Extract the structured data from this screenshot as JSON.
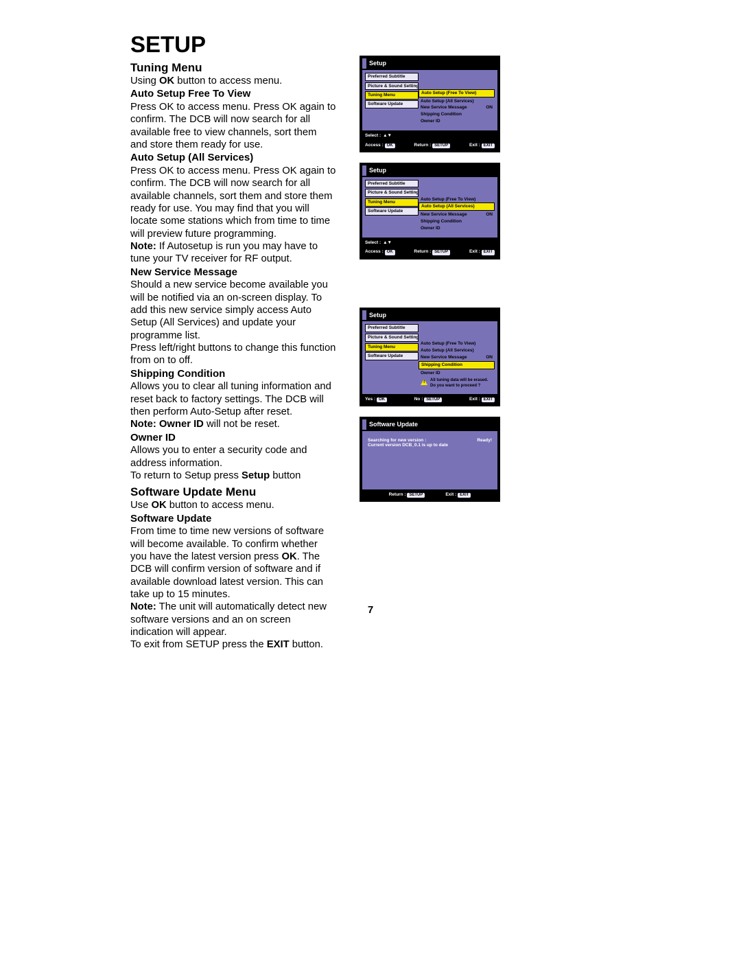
{
  "page": {
    "title": "SETUP",
    "number": "7"
  },
  "sections": {
    "tuning_menu": {
      "heading": "Tuning Menu",
      "intro_pre": "Using ",
      "intro_bold": "OK",
      "intro_post": " button to access menu.",
      "auto_free": {
        "heading": "Auto Setup Free To View",
        "body": "Press OK to access menu. Press OK again to confirm. The DCB will now search for all available free to view channels, sort them and store them ready for use."
      },
      "auto_all": {
        "heading": "Auto Setup (All Services)",
        "body": "Press OK to access menu. Press OK again to confirm. The DCB will now search for all available channels, sort them and store them ready for use. You may find that you will locate some stations which from time to time will preview future programming.",
        "note_label": "Note:",
        "note_body": " If Autosetup is run you may have to tune your TV receiver for RF output."
      },
      "new_service": {
        "heading": "New Service Message",
        "body1": "Should a new service become available you will be notified via an on-screen display. To add this new service simply access Auto Setup (All Services) and update your programme list.",
        "body2": "Press left/right buttons to change this function from on to off."
      },
      "shipping": {
        "heading": "Shipping Condition",
        "body": "Allows you to clear all tuning information and reset back to factory settings. The DCB will then perform Auto-Setup after reset.",
        "note_label": "Note: Owner ID",
        "note_body": " will not be reset."
      },
      "owner": {
        "heading": "Owner ID",
        "body": "Allows you to enter a security code and address information.",
        "return_pre": "To return to Setup press ",
        "return_bold": "Setup",
        "return_post": " button"
      }
    },
    "software_menu": {
      "heading": "Software Update Menu",
      "intro_pre": "Use ",
      "intro_bold": "OK",
      "intro_post": " button to access menu.",
      "sw_update": {
        "heading": "Software Update",
        "body_pre": "From time to time new versions of software will become available. To confirm whether you have the latest version press ",
        "body_bold": "OK",
        "body_post": ". The DCB will confirm version of software and if available download latest version. This can take up to 15 minutes.",
        "note_label": "Note:",
        "note_body": " The unit will automatically detect new software versions and an on screen indication will appear.",
        "exit_pre": "To exit from SETUP press the ",
        "exit_bold": "EXIT",
        "exit_post": " button."
      }
    }
  },
  "screens": {
    "s1": {
      "title": "Setup",
      "left": [
        "Preferred Subtitle",
        "Picture & Sound Setting",
        "Tuning Menu",
        "Software Update"
      ],
      "right_hl": "Auto Setup (Free To View)",
      "right": [
        "Auto Setup (All Services)",
        "New Service Message",
        "Shipping Condition",
        "Owner ID"
      ],
      "on": "ON",
      "foot1a": "Select :",
      "foot1b": "▲▼",
      "foot2a": "Access :",
      "foot2b": "OK",
      "foot3a": "Return :",
      "foot3b": "SETUP",
      "foot4a": "Exit :",
      "foot4b": "EXIT"
    },
    "s2": {
      "title": "Setup",
      "left": [
        "Preferred Subtitle",
        "Picture & Sound Setting",
        "Tuning Menu",
        "Software Update"
      ],
      "right_top": "Auto Setup (Free To View)",
      "right_hl": "Auto Setup (All Services)",
      "right": [
        "New Service Message",
        "Shipping Condition",
        "Owner ID"
      ],
      "on": "ON"
    },
    "s3": {
      "title": "Setup",
      "left": [
        "Preferred Subtitle",
        "Picture & Sound Setting",
        "Tuning Menu",
        "Software Update"
      ],
      "right_top": [
        "Auto Setup (Free To View)",
        "Auto Setup (All Services)",
        "New Service Message"
      ],
      "right_hl": "Shipping Condition",
      "right_bot": "Owner ID",
      "on": "ON",
      "warn1": "All tuning data will be erased.",
      "warn2": "Do you want to proceed ?",
      "foot_yes": "Yes :",
      "foot_no": "No :",
      "foot_exit": "Exit :"
    },
    "s4": {
      "title": "Software Update",
      "line1a": "Searching for new version :",
      "line1b": "Ready!",
      "line2": "Current version DCB_0.1 is up to date"
    }
  }
}
